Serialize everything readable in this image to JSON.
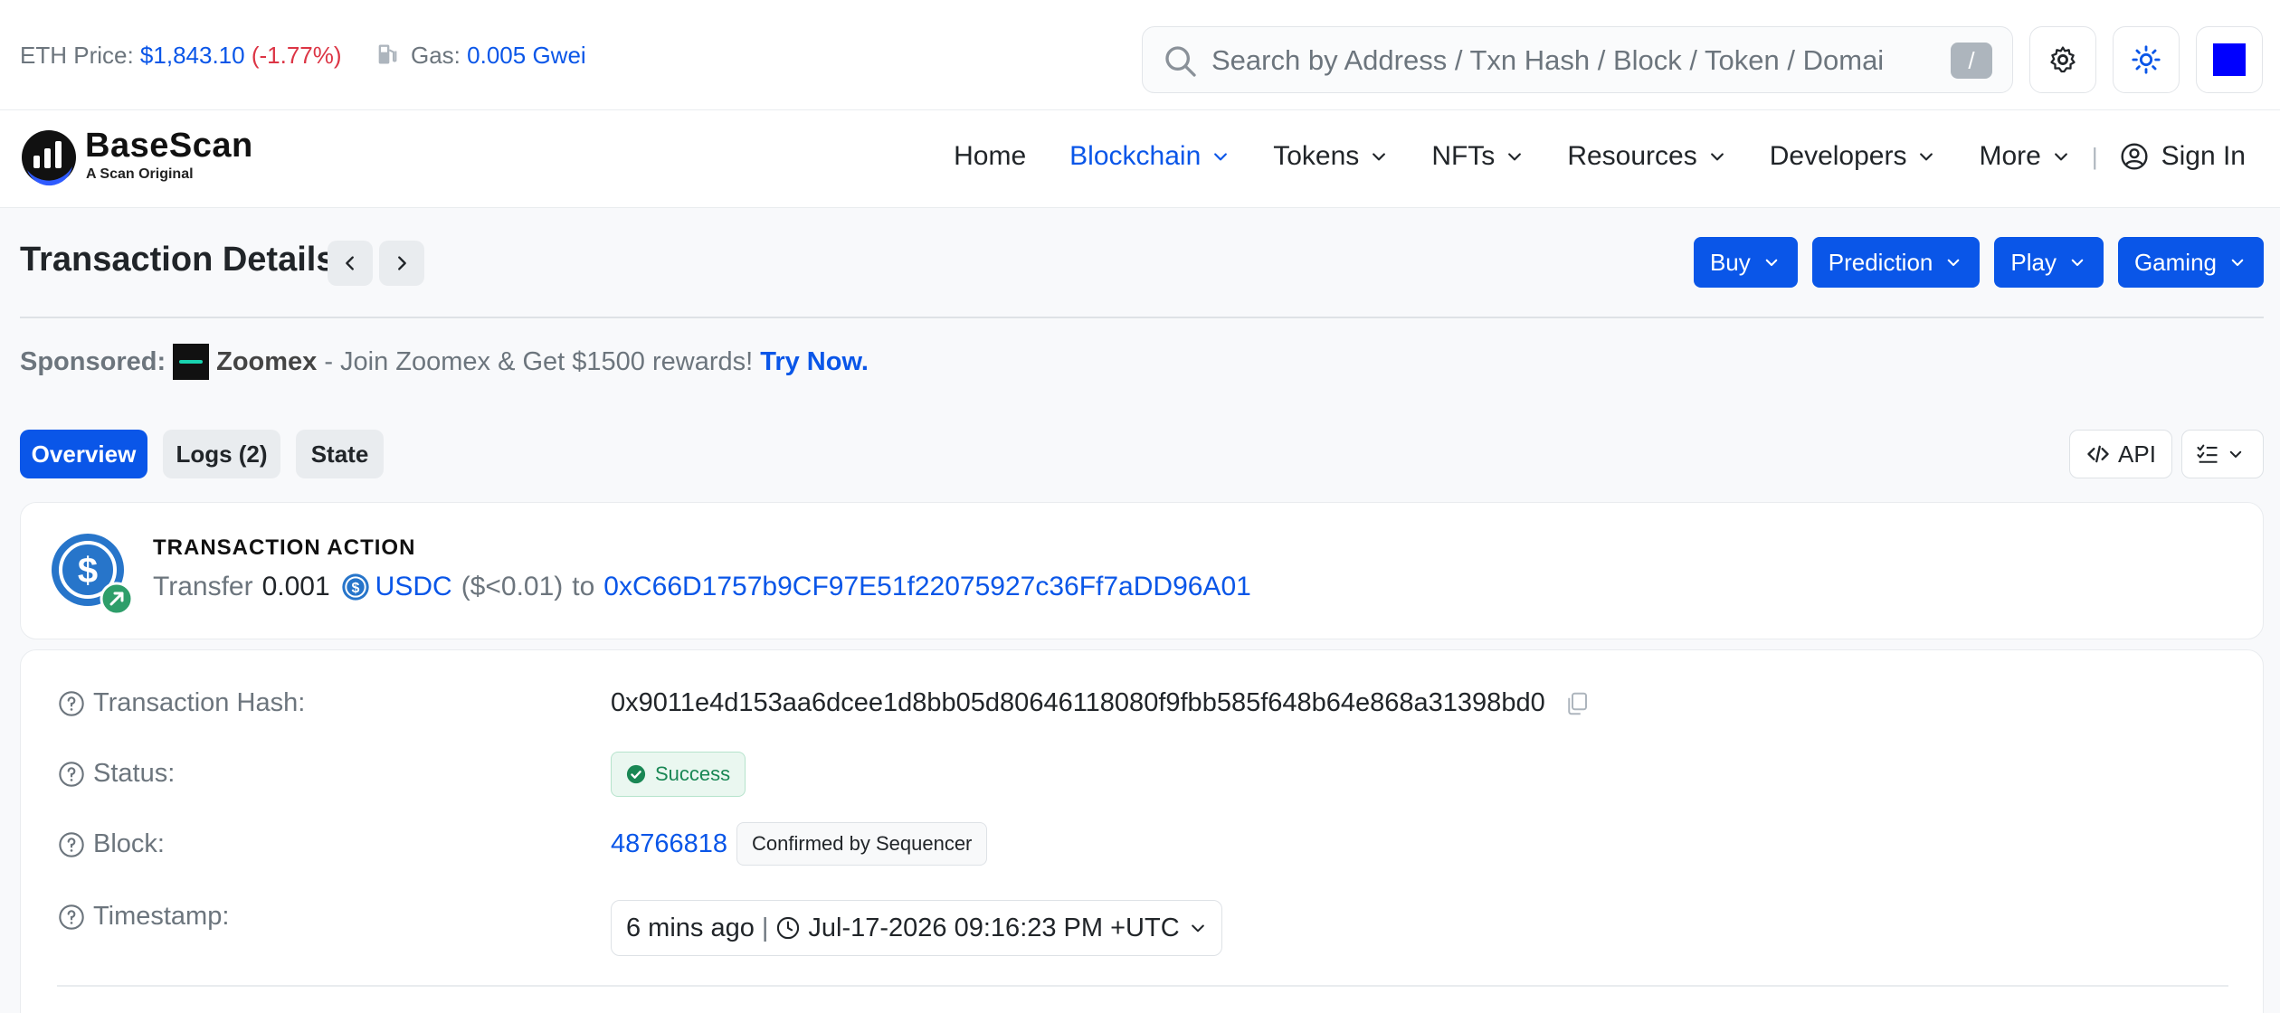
{
  "topbar": {
    "eth_label": "ETH Price:",
    "eth_price": "$1,843.10",
    "eth_change": "(-1.77%)",
    "gas_label": "Gas:",
    "gas_value": "0.005 Gwei",
    "search_placeholder": "Search by Address / Txn Hash / Block / Token / Domai",
    "search_shortcut": "/"
  },
  "brand": {
    "name": "BaseScan",
    "tagline": "A Scan Original"
  },
  "nav": {
    "items": [
      "Home",
      "Blockchain",
      "Tokens",
      "NFTs",
      "Resources",
      "Developers",
      "More"
    ],
    "separator": "|",
    "sign_in": "Sign In"
  },
  "page": {
    "title": "Transaction Details",
    "promos": [
      "Buy",
      "Prediction",
      "Play",
      "Gaming"
    ]
  },
  "sponsored": {
    "label": "Sponsored:",
    "name": "Zoomex",
    "text": " - Join Zoomex & Get $1500 rewards! ",
    "cta": "Try Now."
  },
  "tabs": [
    "Overview",
    "Logs (2)",
    "State"
  ],
  "tools": {
    "api": "API"
  },
  "action": {
    "title": "TRANSACTION ACTION",
    "verb": "Transfer",
    "amount": "0.001",
    "token": "USDC",
    "usd": "($<0.01)",
    "to_label": "to",
    "to_address": "0xC66D1757b9CF97E51f22075927c36Ff7aDD96A01"
  },
  "details": {
    "hash_label": "Transaction Hash:",
    "hash_value": "0x9011e4d153aa6dcee1d8bb05d80646118080f9fbb585f648b64e868a31398bd0",
    "status_label": "Status:",
    "status_value": "Success",
    "block_label": "Block:",
    "block_value": "48766818",
    "block_badge": "Confirmed by Sequencer",
    "ts_label": "Timestamp:",
    "ts_ago": "6 mins ago",
    "ts_sep": "|",
    "ts_value": "Jul-17-2026 09:16:23 PM +UTC"
  },
  "colors": {
    "accent": "#0a56e8",
    "negative": "#dc3545",
    "success": "#198754"
  }
}
